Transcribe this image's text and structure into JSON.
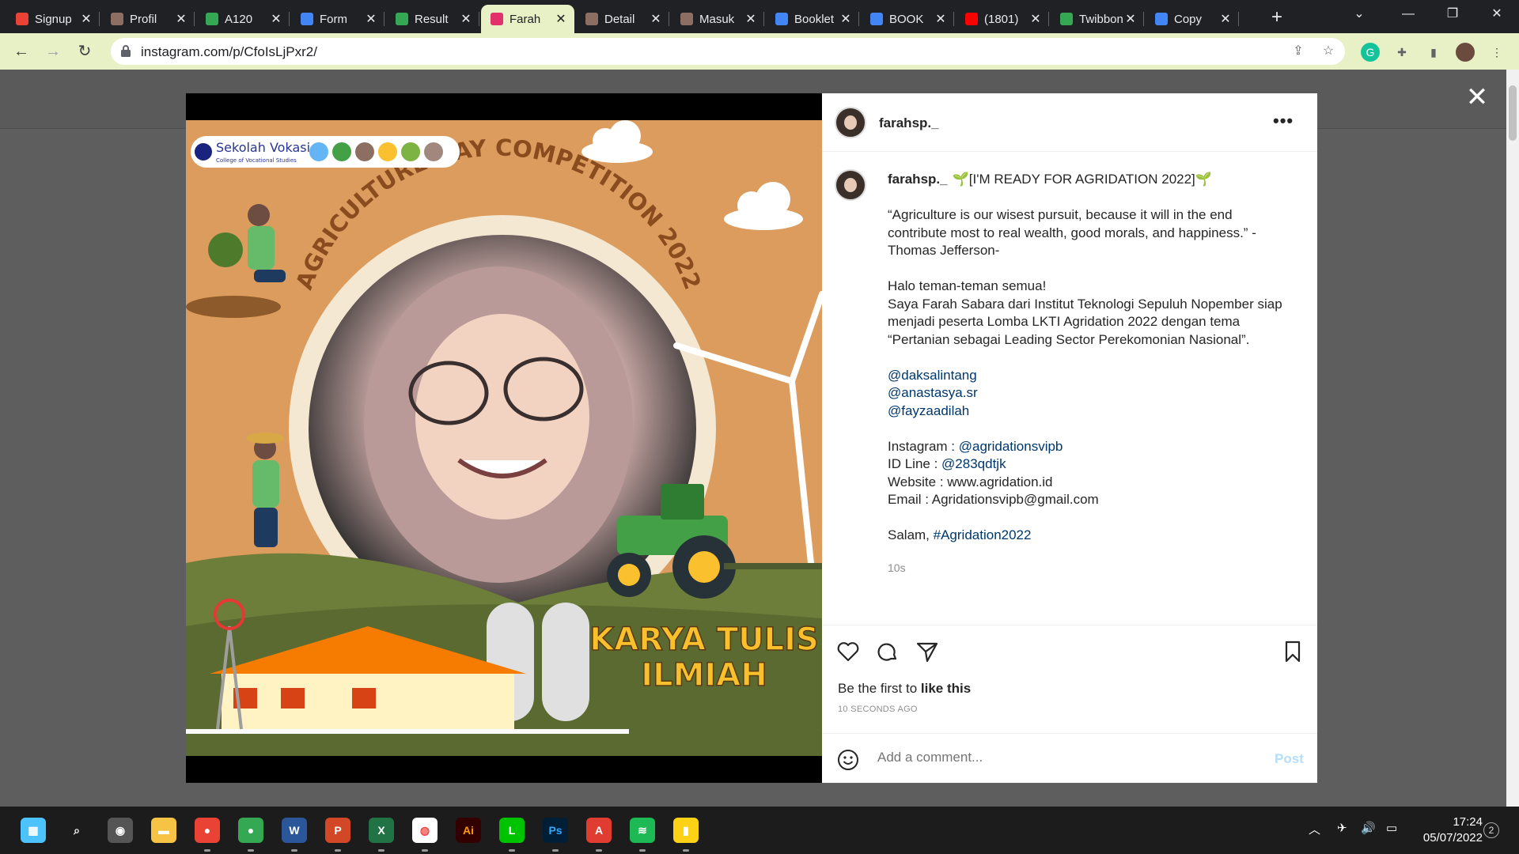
{
  "browser": {
    "tabs": [
      {
        "label": "Signup",
        "icon": "gmail-icon",
        "color": "#ea4335"
      },
      {
        "label": "Profil",
        "icon": "site-icon",
        "color": "#8d6e63"
      },
      {
        "label": "A120",
        "icon": "google-drive-icon",
        "color": "#34a853"
      },
      {
        "label": "Form",
        "icon": "google-forms-icon",
        "color": "#4285f4"
      },
      {
        "label": "Result",
        "icon": "google-drive-icon",
        "color": "#34a853"
      },
      {
        "label": "Farah",
        "icon": "instagram-icon",
        "color": "#e1306c",
        "active": true
      },
      {
        "label": "Detail",
        "icon": "site-icon",
        "color": "#8d6e63"
      },
      {
        "label": "Masuk",
        "icon": "site-icon",
        "color": "#8d6e63"
      },
      {
        "label": "Booklet",
        "icon": "google-docs-icon",
        "color": "#4285f4"
      },
      {
        "label": "BOOK",
        "icon": "google-docs-icon",
        "color": "#4285f4"
      },
      {
        "label": "(1801)",
        "icon": "youtube-icon",
        "color": "#ff0000"
      },
      {
        "label": "Twibbon",
        "icon": "google-drive-icon",
        "color": "#34a853"
      },
      {
        "label": "Copy",
        "icon": "google-docs-icon",
        "color": "#4285f4"
      }
    ],
    "url": "instagram.com/p/CfoIsLjPxr2/",
    "accent": "#e8f0c6"
  },
  "post": {
    "username": "farahsp._",
    "caption_lines": [
      {
        "text": "🌱[I'M READY FOR AGRIDATION 2022]🌱",
        "user": true
      },
      {
        "text": ""
      },
      {
        "text": "“Agriculture is our wisest pursuit, because it will in the end"
      },
      {
        "text": "contribute most to real wealth, good morals, and happiness.” -"
      },
      {
        "text": "Thomas Jefferson-"
      },
      {
        "text": ""
      },
      {
        "text": "Halo teman-teman semua!"
      },
      {
        "text": "Saya Farah Sabara dari Institut Teknologi Sepuluh Nopember siap"
      },
      {
        "text": "menjadi peserta Lomba LKTI Agridation 2022 dengan tema"
      },
      {
        "text": "“Pertanian sebagai Leading Sector Perekomonian Nasional”."
      },
      {
        "text": ""
      },
      {
        "text": "@daksalintang",
        "link": true
      },
      {
        "text": "@anastasya.sr",
        "link": true
      },
      {
        "text": "@fayzaadilah",
        "link": true
      },
      {
        "text": ""
      },
      {
        "pre": "Instagram : ",
        "link_text": "@agridationsvipb"
      },
      {
        "pre": "ID Line : ",
        "link_text": "@283qdtjk"
      },
      {
        "text": "Website : www.agridation.id"
      },
      {
        "text": "Email : Agridationsvipb@gmail.com"
      },
      {
        "text": ""
      },
      {
        "pre": "Salam, ",
        "link_text": "#Agridation2022"
      }
    ],
    "time": "10s",
    "likes_prefix": "Be the first to ",
    "likes_bold": "like this",
    "ago": "10 SECONDS AGO",
    "comment_placeholder": "Add a comment...",
    "post_button": "Post",
    "image": {
      "logo_text": "Sekolah Vokasi",
      "logo_sub": "College of Vocational Studies",
      "arc_title": "AGRICULTURE DAY COMPETITION 2022",
      "banner_line1": "KARYA TULIS",
      "banner_line2": "ILMIAH"
    }
  },
  "taskbar": {
    "apps": [
      "windows-start-icon",
      "search-icon",
      "camera-icon",
      "file-explorer-icon",
      "chrome-icon",
      "chrome-profile-icon",
      "word-icon",
      "powerpoint-icon",
      "excel-icon",
      "browser-icon",
      "illustrator-icon",
      "line-icon",
      "photoshop-icon",
      "acrobat-icon",
      "spotify-icon",
      "sticky-notes-icon"
    ],
    "time": "17:24",
    "date": "05/07/2022",
    "notifications": "2"
  }
}
